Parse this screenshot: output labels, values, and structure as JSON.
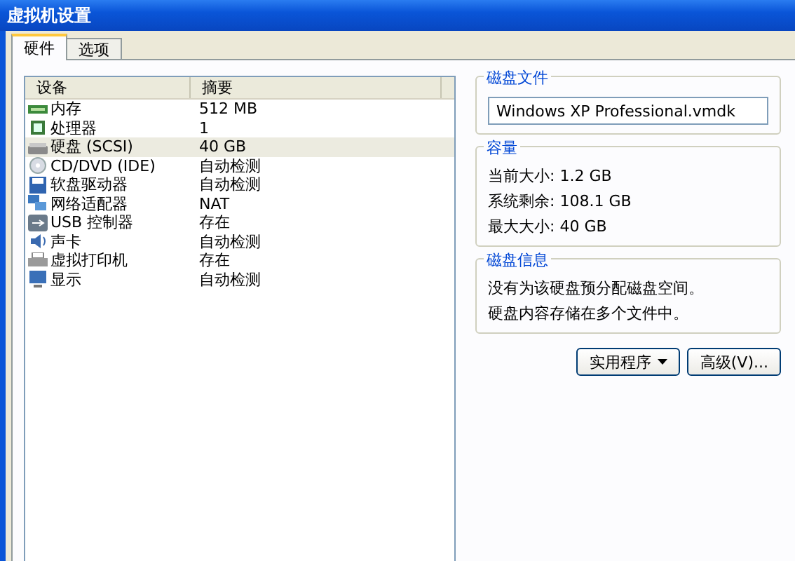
{
  "window": {
    "title": "虚拟机设置"
  },
  "tabs": [
    {
      "label": "硬件",
      "selected": true
    },
    {
      "label": "选项",
      "selected": false
    }
  ],
  "device_table": {
    "columns": [
      "设备",
      "摘要"
    ],
    "rows": [
      {
        "kind": "memory",
        "device": "内存",
        "summary": "512 MB",
        "selected": false
      },
      {
        "kind": "processor",
        "device": "处理器",
        "summary": "1",
        "selected": false
      },
      {
        "kind": "disk",
        "device": "硬盘 (SCSI)",
        "summary": "40 GB",
        "selected": true
      },
      {
        "kind": "cd",
        "device": "CD/DVD (IDE)",
        "summary": "自动检测",
        "selected": false
      },
      {
        "kind": "floppy",
        "device": "软盘驱动器",
        "summary": "自动检测",
        "selected": false
      },
      {
        "kind": "network",
        "device": "网络适配器",
        "summary": "NAT",
        "selected": false
      },
      {
        "kind": "usb",
        "device": "USB 控制器",
        "summary": "存在",
        "selected": false
      },
      {
        "kind": "sound",
        "device": "声卡",
        "summary": "自动检测",
        "selected": false
      },
      {
        "kind": "printer",
        "device": "虚拟打印机",
        "summary": "存在",
        "selected": false
      },
      {
        "kind": "display",
        "device": "显示",
        "summary": "自动检测",
        "selected": false
      }
    ]
  },
  "disk_file": {
    "title": "磁盘文件",
    "value": "Windows XP Professional.vmdk"
  },
  "capacity": {
    "title": "容量",
    "lines": [
      "当前大小: 1.2 GB",
      "系统剩余: 108.1 GB",
      "最大大小: 40 GB"
    ]
  },
  "disk_info": {
    "title": "磁盘信息",
    "lines": [
      "没有为该硬盘预分配磁盘空间。",
      "硬盘内容存储在多个文件中。"
    ]
  },
  "buttons": [
    {
      "label": "实用程序",
      "dropdown": true
    },
    {
      "label": "高级(V)...",
      "dropdown": false
    }
  ]
}
